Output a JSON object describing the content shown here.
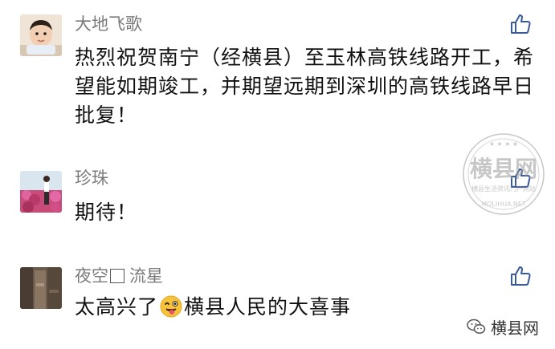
{
  "comments": [
    {
      "nickname": "大地飞歌",
      "text": "热烈祝贺南宁（经横县）至玉林高铁线路开工，希望能如期竣工，并期望远期到深圳的高铁线路早日批复！"
    },
    {
      "nickname": "珍珠",
      "text": "期待！"
    },
    {
      "nickname_part1": "夜空",
      "nickname_part2": "流星",
      "text_before_emoji": "太高兴了",
      "text_after_emoji": "横县人民的大喜事"
    }
  ],
  "watermark": {
    "main": "横县网",
    "sub": "横县生活资讯门户网站",
    "url": "MOLIHUA.NET"
  },
  "brand_label": "横县网",
  "icons": {
    "like": "thumbs-up-icon",
    "emoji": "winking-tongue-emoji-icon",
    "brand": "wechat-icon"
  },
  "colors": {
    "nickname": "#7a7a7a",
    "text": "#111111",
    "like_stroke": "#3a5a9a"
  }
}
